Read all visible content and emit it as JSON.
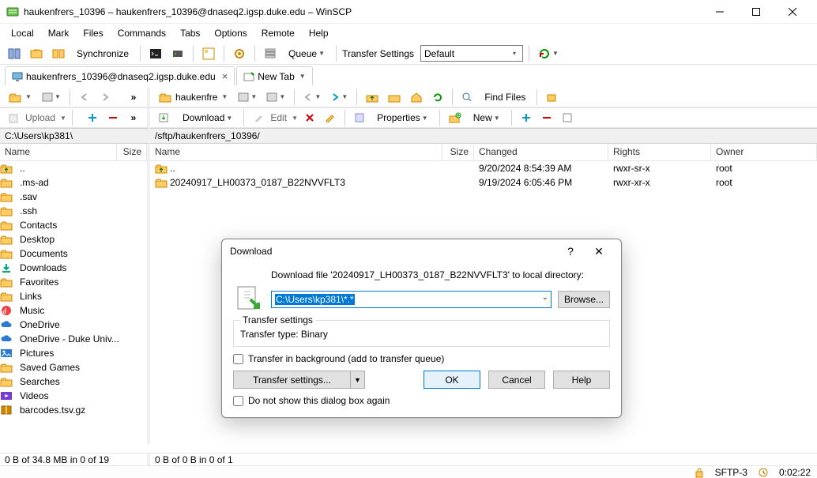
{
  "window": {
    "title": "haukenfrers_10396 – haukenfrers_10396@dnaseq2.igsp.duke.edu – WinSCP"
  },
  "menu": {
    "local": "Local",
    "mark": "Mark",
    "files": "Files",
    "commands": "Commands",
    "tabs": "Tabs",
    "options": "Options",
    "remote": "Remote",
    "help": "Help"
  },
  "toolbar": {
    "synchronize": "Synchronize",
    "queue": "Queue",
    "transfer_settings_label": "Transfer Settings",
    "transfer_settings_value": "Default"
  },
  "tabs": {
    "active": "haukenfrers_10396@dnaseq2.igsp.duke.edu",
    "new_tab": "New Tab"
  },
  "navL": {
    "folder_label": ""
  },
  "navR": {
    "folder_label": "haukenfre",
    "find": "Find Files"
  },
  "actionbar": {
    "upload": "Upload",
    "download": "Download",
    "edit": "Edit",
    "properties": "Properties",
    "new": "New"
  },
  "paths": {
    "left": "C:\\Users\\kp381\\",
    "right": "/sftp/haukenfrers_10396/"
  },
  "cols": {
    "name": "Name",
    "size": "Size",
    "changed": "Changed",
    "rights": "Rights",
    "owner": "Owner"
  },
  "left_files": {
    "items": [
      {
        "name": "..",
        "icon": "folder-up"
      },
      {
        "name": ".ms-ad",
        "icon": "folder"
      },
      {
        "name": ".sav",
        "icon": "folder"
      },
      {
        "name": ".ssh",
        "icon": "folder"
      },
      {
        "name": "Contacts",
        "icon": "folder"
      },
      {
        "name": "Desktop",
        "icon": "folder"
      },
      {
        "name": "Documents",
        "icon": "folder"
      },
      {
        "name": "Downloads",
        "icon": "download"
      },
      {
        "name": "Favorites",
        "icon": "folder"
      },
      {
        "name": "Links",
        "icon": "folder"
      },
      {
        "name": "Music",
        "icon": "music"
      },
      {
        "name": "OneDrive",
        "icon": "cloud"
      },
      {
        "name": "OneDrive - Duke Univ...",
        "icon": "cloud"
      },
      {
        "name": "Pictures",
        "icon": "pictures"
      },
      {
        "name": "Saved Games",
        "icon": "folder"
      },
      {
        "name": "Searches",
        "icon": "folder"
      },
      {
        "name": "Videos",
        "icon": "videos"
      },
      {
        "name": "barcodes.tsv.gz",
        "icon": "archive"
      }
    ]
  },
  "right_files": {
    "items": [
      {
        "name": "..",
        "changed": "9/20/2024 8:54:39 AM",
        "rights": "rwxr-sr-x",
        "owner": "root",
        "icon": "folder-up"
      },
      {
        "name": "20240917_LH00373_0187_B22NVVFLT3",
        "changed": "9/19/2024 6:05:46 PM",
        "rights": "rwxr-xr-x",
        "owner": "root",
        "icon": "folder"
      }
    ]
  },
  "status": {
    "left": "0 B of 34.8 MB in 0 of 19",
    "right": "0 B of 0 B in 0 of 1",
    "protocol": "SFTP-3",
    "time": "0:02:22"
  },
  "dialog": {
    "title": "Download",
    "prompt": "Download file '20240917_LH00373_0187_B22NVVFLT3' to local directory:",
    "path_value": "C:\\Users\\kp381\\*.*",
    "browse": "Browse...",
    "group_label": "Transfer settings",
    "transfer_type": "Transfer type: Binary",
    "bg_checkbox": "Transfer in background (add to transfer queue)",
    "transfer_settings_btn": "Transfer settings...",
    "ok": "OK",
    "cancel": "Cancel",
    "help": "Help",
    "noshow": "Do not show this dialog box again"
  }
}
